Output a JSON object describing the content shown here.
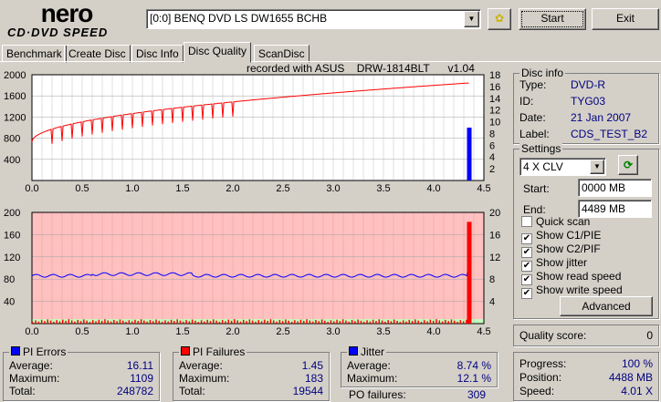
{
  "logo": {
    "top": "nero",
    "bottom": "CD·DVD SPEED"
  },
  "drive": "[0:0]  BENQ DVD LS DW1655 BCHB",
  "buttons": {
    "start": "Start",
    "exit": "Exit",
    "advanced": "Advanced"
  },
  "tabs": [
    "Benchmark",
    "Create Disc",
    "Disc Info",
    "Disc Quality",
    "ScanDisc"
  ],
  "active_tab": "Disc Quality",
  "recorded_with": "recorded with ASUS    DRW-1814BLT      v1.04",
  "disc_info": {
    "title": "Disc info",
    "type_label": "Type:",
    "type": "DVD-R",
    "id_label": "ID:",
    "id": "TYG03",
    "date_label": "Date:",
    "date": "21 Jan 2007",
    "label_label": "Label:",
    "label": "CDS_TEST_B2"
  },
  "settings": {
    "title": "Settings",
    "speed": "4 X CLV",
    "start_label": "Start:",
    "start": "0000 MB",
    "end_label": "End:",
    "end": "4489 MB",
    "checks": [
      {
        "label": "Quick scan",
        "checked": false
      },
      {
        "label": "Show C1/PIE",
        "checked": true
      },
      {
        "label": "Show C2/PIF",
        "checked": true
      },
      {
        "label": "Show jitter",
        "checked": true
      },
      {
        "label": "Show read speed",
        "checked": true
      },
      {
        "label": "Show write speed",
        "checked": true
      }
    ]
  },
  "quality": {
    "label": "Quality score:",
    "value": "0"
  },
  "progress": {
    "progress_label": "Progress:",
    "progress": "100 %",
    "position_label": "Position:",
    "position": "4488 MB",
    "speed_label": "Speed:",
    "speed": "4.01 X"
  },
  "pi_errors": {
    "title": "PI Errors",
    "color": "#0000ff",
    "avg_label": "Average:",
    "avg": "16.11",
    "max_label": "Maximum:",
    "max": "1109",
    "total_label": "Total:",
    "total": "248782"
  },
  "pi_failures": {
    "title": "PI Failures",
    "color": "#ff0000",
    "avg_label": "Average:",
    "avg": "1.45",
    "max_label": "Maximum:",
    "max": "183",
    "total_label": "Total:",
    "total": "19544"
  },
  "jitter": {
    "title": "Jitter",
    "color": "#0000ff",
    "avg_label": "Average:",
    "avg": "8.74 %",
    "max_label": "Maximum:",
    "max": "12.1 %"
  },
  "po_failures": {
    "label": "PO failures:",
    "value": "309"
  },
  "chart_data": [
    {
      "type": "line",
      "name": "top",
      "x_ticks": [
        "0.0",
        "0.5",
        "1.0",
        "1.5",
        "2.0",
        "2.5",
        "3.0",
        "3.5",
        "4.0",
        "4.5"
      ],
      "y_left_ticks": [
        "2000",
        "1600",
        "1200",
        "800",
        "400"
      ],
      "y_right_ticks": [
        "18",
        "16",
        "14",
        "12",
        "10",
        "8",
        "6",
        "4",
        "2"
      ],
      "xlim": [
        0,
        4.5
      ],
      "ylim_left": [
        0,
        2000
      ],
      "ylim_right": [
        0,
        18
      ],
      "read_speed": {
        "x": [
          0,
          4.35
        ],
        "y": [
          6.6,
          16.6
        ]
      },
      "pi_errors_spike": {
        "x": 4.35,
        "y": 1000
      }
    },
    {
      "type": "line",
      "name": "bottom",
      "x_ticks": [
        "0.0",
        "0.5",
        "1.0",
        "1.5",
        "2.0",
        "2.5",
        "3.0",
        "3.5",
        "4.0",
        "4.5"
      ],
      "y_left_ticks": [
        "200",
        "160",
        "120",
        "80",
        "40"
      ],
      "y_right_ticks": [
        "20",
        "16",
        "12",
        "8",
        "4"
      ],
      "xlim": [
        0,
        4.5
      ],
      "ylim_left": [
        0,
        200
      ],
      "ylim_right": [
        0,
        20
      ],
      "jitter_avg": 8.6,
      "jitter_end": 12.1,
      "pif_spike": {
        "x": 4.35,
        "y": 183
      }
    }
  ]
}
